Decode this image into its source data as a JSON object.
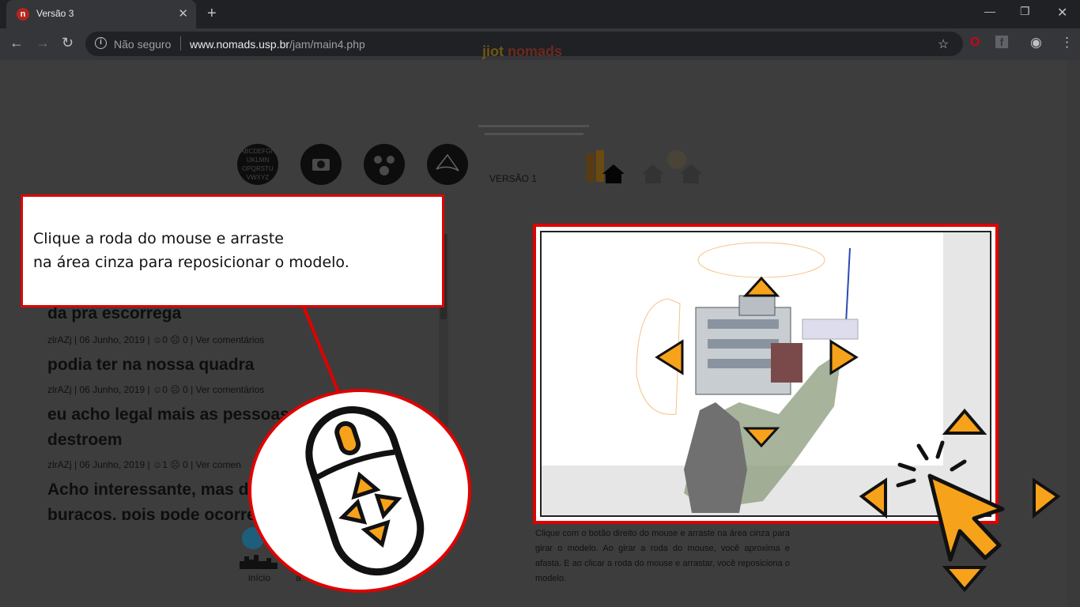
{
  "browser": {
    "tab_title": "Versão 3",
    "favicon_letter": "n",
    "new_tab": "+",
    "security_label": "Não seguro",
    "url_domain": "www.nomads.usp.br",
    "url_path": "/jam/main4.php"
  },
  "header": {
    "logo_left": "jiot",
    "logo_right": "nomads",
    "circles": [
      "ABCDEFGH IJKLMN OPQRSTU VWXYZ",
      "camera",
      "people",
      "shape"
    ],
    "version_label": "VERSÃO 1"
  },
  "callout": {
    "line1": "Clique a roda do mouse e arraste",
    "line2": "na área cinza para reposicionar o modelo."
  },
  "posts": [
    {
      "title": "da pra escorrega",
      "meta": "zlrAZj | 06 Junho, 2019 | ☺0 ☹ 0 | Ver comentários"
    },
    {
      "title": "podia ter na nossa quadra",
      "meta": "zlrAZj | 06 Junho, 2019 | ☺0 ☹ 0 | Ver comentários"
    },
    {
      "title": "eu acho legal mais as pessoas",
      "title2": "destroem",
      "meta": "zlrAZj | 06 Junho, 2019 | ☺1 ☹ 0 | Ver comen"
    },
    {
      "title": "Acho interessante, mas de",
      "title2": "buracos, pois pode ocorre"
    }
  ],
  "bottom_nav": {
    "home_label": "início",
    "second_label": "a"
  },
  "caption": "Clique com o botão direito do mouse e arraste na área cinza para girar o modelo. Ao girar a roda do mouse, você aproxima e afasta. E ao clicar a roda do mouse e arrastar, você reposiciona o modelo.",
  "colors": {
    "accent_red": "#e00000",
    "arrow_orange": "#f7a21b",
    "page_dim": "#3d3d3d"
  }
}
